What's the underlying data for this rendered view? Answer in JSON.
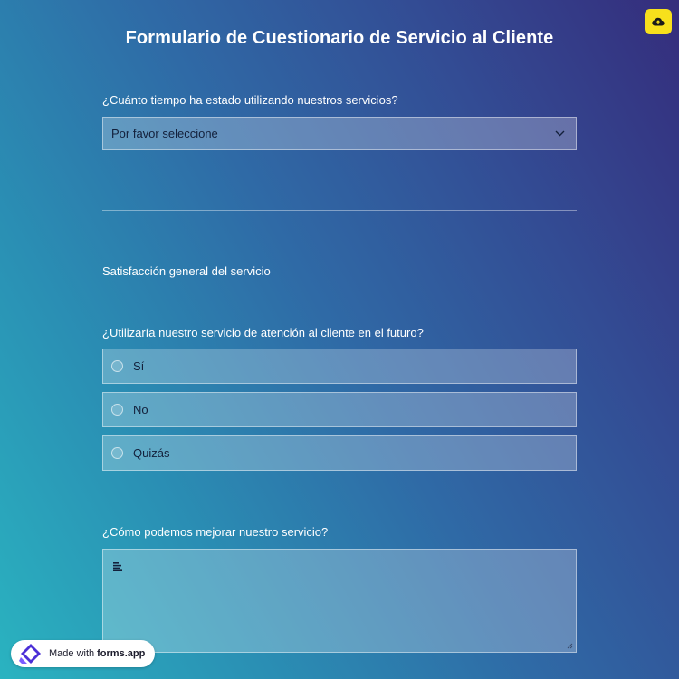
{
  "header": {
    "title": "Formulario de Cuestionario de Servicio al Cliente",
    "save_icon": "cloud-upload-icon",
    "accent_color": "#f7e01c"
  },
  "questions": {
    "q1": {
      "label": "¿Cuánto tiempo ha estado utilizando nuestros servicios?",
      "selected": "Por favor seleccione",
      "icon": "chevron-down-icon"
    },
    "section": {
      "title": "Satisfacción general del servicio"
    },
    "q2": {
      "label": "¿Utilizaría nuestro servicio de atención al cliente en el futuro?",
      "options": [
        "Sí",
        "No",
        "Quizás"
      ]
    },
    "q3": {
      "label": "¿Cómo podemos mejorar nuestro servicio?",
      "value": "",
      "icon": "text-lines-icon"
    }
  },
  "badge": {
    "prefix": "Made with",
    "brand": "forms.app"
  }
}
